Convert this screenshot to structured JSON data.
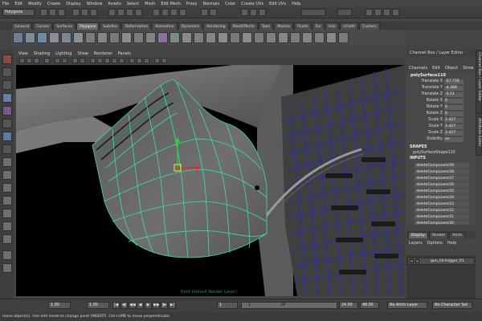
{
  "menu_bar": {
    "items": [
      "File",
      "Edit",
      "Modify",
      "Create",
      "Display",
      "Window",
      "Assets",
      "Select",
      "Mesh",
      "Edit Mesh",
      "Proxy",
      "Normals",
      "Color",
      "Create UVs",
      "Edit UVs",
      "Help"
    ]
  },
  "status_line": {
    "mode": "Polygons"
  },
  "shelf": {
    "tabs": [
      "General",
      "Curves",
      "Surfaces",
      "Polygons",
      "Subdivs",
      "Deformation",
      "Animation",
      "Dynamics",
      "Rendering",
      "PaintEffects",
      "Toon",
      "Muscle",
      "Fluids",
      "Fur",
      "Hair",
      "nCloth",
      "Custom"
    ],
    "active_tab": "Polygons"
  },
  "viewport": {
    "menu": [
      "View",
      "Shading",
      "Lighting",
      "Show",
      "Renderer",
      "Panels"
    ],
    "camera_label": "front (default Render Layer)"
  },
  "channel_box": {
    "title": "Channel Box / Layer Editor",
    "menu": [
      "Channels",
      "Edit",
      "Object",
      "Show"
    ],
    "object_name": "polySurface110",
    "attributes": [
      {
        "label": "Translate X",
        "value": "-57.776"
      },
      {
        "label": "Translate Y",
        "value": "-4.368"
      },
      {
        "label": "Translate Z",
        "value": "-5.51"
      },
      {
        "label": "Rotate X",
        "value": "0"
      },
      {
        "label": "Rotate Y",
        "value": "0"
      },
      {
        "label": "Rotate Z",
        "value": "0"
      },
      {
        "label": "Scale X",
        "value": "2.427"
      },
      {
        "label": "Scale Y",
        "value": "2.427"
      },
      {
        "label": "Scale Z",
        "value": "2.427"
      },
      {
        "label": "Visibility",
        "value": "on"
      }
    ],
    "shapes_header": "SHAPES",
    "shape_name": "polySurfaceShape110",
    "inputs_header": "INPUTS",
    "inputs": [
      "deleteComponent39",
      "deleteComponent38",
      "deleteComponent37",
      "deleteComponent36",
      "deleteComponent35",
      "deleteComponent34",
      "deleteComponent33",
      "deleteComponent32",
      "deleteComponent31",
      "deleteComponent30"
    ],
    "side_tabs": [
      "Channel Box / Layer Editor",
      "Attribute Editor"
    ]
  },
  "layer_editor": {
    "tabs": [
      "Display",
      "Render",
      "Anim"
    ],
    "active_tab": "Display",
    "menu": [
      "Layers",
      "Options",
      "Help"
    ],
    "layers": [
      {
        "name": "gun_lib:trigger_01"
      }
    ]
  },
  "time_slider": {
    "start_frame": "1.00",
    "current_frame": "1.00",
    "range_start_field": "1",
    "range_marker_start": "1",
    "range_marker_end": "24",
    "range_end_field": "24.00",
    "playback_end": "48.00",
    "anim_layer": "No Anim Layer",
    "character_set": "No Character Set",
    "playback_buttons": [
      "|◀",
      "◀|",
      "◀◀",
      "◀",
      "▶",
      "▶▶",
      "|▶",
      "▶|"
    ]
  },
  "help_line": {
    "text": "move object(s). Use edit mode to change pivot (INSERT). Ctrl+LMB to move perpendicular."
  }
}
